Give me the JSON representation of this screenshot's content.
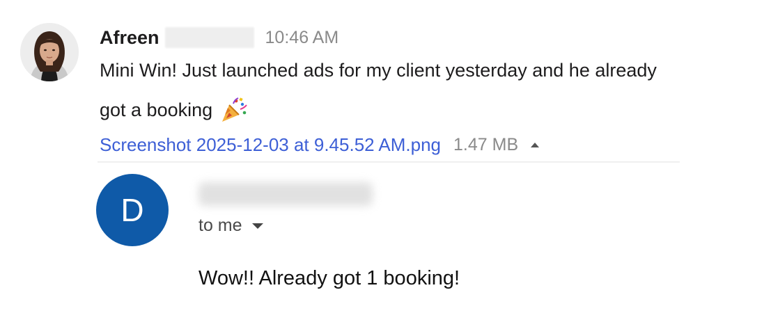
{
  "chat_message": {
    "sender_first_name": "Afreen",
    "timestamp": "10:46 AM",
    "text_line_1": "Mini Win! Just launched ads for my client yesterday and he already",
    "text_line_2": "got a booking",
    "emoji_icon": "party-popper-icon",
    "attachment": {
      "filename": "Screenshot 2025-12-03 at 9.45.52 AM.png",
      "size": "1.47 MB"
    }
  },
  "email": {
    "avatar_letter": "D",
    "recipient_label": "to me",
    "body": "Wow!! Already got 1 booking!"
  },
  "colors": {
    "link": "#3d5fd6",
    "avatar_bg": "#0f5aa8",
    "muted_text": "#8a8a8a"
  }
}
